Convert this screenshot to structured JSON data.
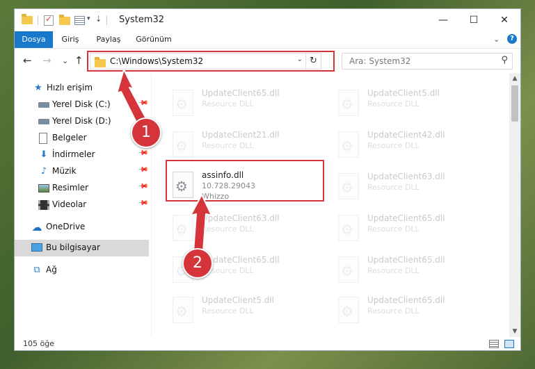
{
  "window": {
    "title": "System32",
    "minimize": "—",
    "maximize": "☐",
    "close": "✕"
  },
  "ribbon": {
    "tabs": [
      "Dosya",
      "Giriş",
      "Paylaş",
      "Görünüm"
    ],
    "expand": "⌄",
    "help": "?"
  },
  "navbar": {
    "back": "←",
    "forward": "→",
    "recent": "⌄",
    "up": "↑",
    "address": "C:\\Windows\\System32",
    "address_dropdown": "⌄",
    "refresh": "↻",
    "search_placeholder": "Ara: System32",
    "search_icon": "⚲"
  },
  "sidebar": {
    "items": [
      {
        "label": "Hızlı erişim",
        "icon": "star-icon",
        "glyph": "★"
      },
      {
        "label": "Yerel Disk (C:)",
        "icon": "drive-icon",
        "pinned": true
      },
      {
        "label": "Yerel Disk (D:)",
        "icon": "drive-icon",
        "pinned": true
      },
      {
        "label": "Belgeler",
        "icon": "document-icon",
        "pinned": true
      },
      {
        "label": "İndirmeler",
        "icon": "download-icon",
        "glyph": "⬇",
        "pinned": true
      },
      {
        "label": "Müzik",
        "icon": "music-icon",
        "glyph": "♪",
        "pinned": true
      },
      {
        "label": "Resimler",
        "icon": "pictures-icon",
        "pinned": true
      },
      {
        "label": "Videolar",
        "icon": "videos-icon",
        "pinned": true
      },
      {
        "label": "OneDrive",
        "icon": "cloud-icon",
        "glyph": "☁"
      },
      {
        "label": "Bu bilgisayar",
        "icon": "computer-icon",
        "selected": true
      },
      {
        "label": "Ağ",
        "icon": "network-icon",
        "glyph": "⧉"
      }
    ],
    "pin_glyph": "📌"
  },
  "files": [
    {
      "name": "UpdateClient65.dll",
      "line2": "Resource DLL"
    },
    {
      "name": "UpdateClient5.dll",
      "line2": "Resource DLL"
    },
    {
      "name": "UpdateClient21.dll",
      "line2": "Resource DLL"
    },
    {
      "name": "UpdateClient42.dll",
      "line2": "Resource DLL"
    },
    {
      "name": "assinfo.dll",
      "line2": "10.728.29043",
      "line3": "Whizzo",
      "highlight": true
    },
    {
      "name": "UpdateClient63.dll",
      "line2": "Resource DLL"
    },
    {
      "name": "UpdateClient63.dll",
      "line2": "Resource DLL"
    },
    {
      "name": "UpdateClient65.dll",
      "line2": "Resource DLL"
    },
    {
      "name": "UpdateClient65.dll",
      "line2": "Resource DLL"
    },
    {
      "name": "UpdateClient65.dll",
      "line2": "Resource DLL"
    },
    {
      "name": "UpdateClient5.dll",
      "line2": "Resource DLL"
    },
    {
      "name": "UpdateClient65.dll",
      "line2": "Resource DLL"
    }
  ],
  "scrollbar": {
    "up": "▲",
    "down": "▼"
  },
  "status": {
    "item_count": "105 öğe"
  },
  "callouts": [
    {
      "number": "1"
    },
    {
      "number": "2"
    }
  ],
  "colors": {
    "accent": "#1979ca",
    "callout": "#d6343b"
  }
}
